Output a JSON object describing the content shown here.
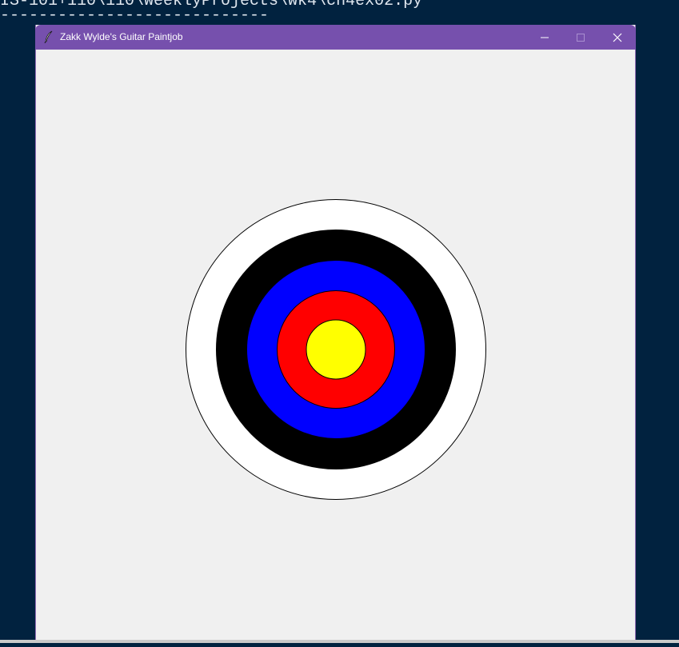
{
  "terminal": {
    "line1": "IS-101+110\\110\\WeeklyProjects\\wk4\\ch4ex02.py",
    "line2": "----------------------------"
  },
  "window": {
    "title": "Zakk Wylde's Guitar Paintjob",
    "title_icon": "feather-icon",
    "titlebar_color": "#7650ad",
    "controls": [
      "minimize-icon",
      "maximize-icon",
      "close-icon"
    ]
  },
  "target": {
    "rings_outer_to_inner": [
      "#ffffff",
      "#000000",
      "#0000ff",
      "#ff0000",
      "#ffff00"
    ],
    "outline_color": "#000000"
  }
}
